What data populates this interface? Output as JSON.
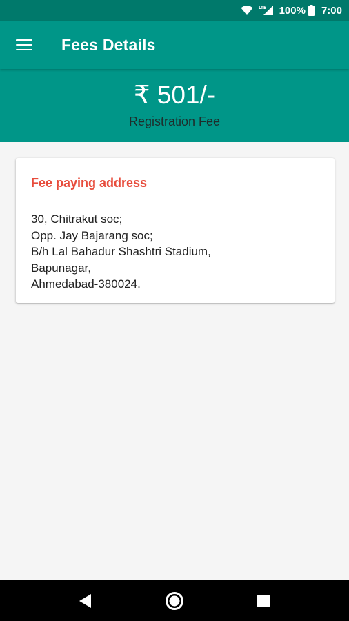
{
  "status_bar": {
    "battery": "100%",
    "time": "7:00",
    "icons": [
      "wifi-icon",
      "lte-signal-icon",
      "battery-icon"
    ]
  },
  "app_bar": {
    "title": "Fees Details",
    "menu_icon": "hamburger-menu-icon"
  },
  "fee": {
    "amount": "₹ 501/-",
    "label": "Registration Fee"
  },
  "address_card": {
    "title": "Fee paying address",
    "lines": [
      "30, Chitrakut soc;",
      "Opp. Jay Bajarang soc;",
      "B/h Lal Bahadur Shashtri Stadium,",
      "Bapunagar,",
      "Ahmedabad-380024."
    ]
  },
  "nav_bar": {
    "icons": [
      "back-icon",
      "home-icon",
      "recents-icon"
    ]
  },
  "colors": {
    "primary": "#009688",
    "primary_dark": "#00796b",
    "accent_red": "#e74c3c",
    "background": "#f5f5f5"
  }
}
